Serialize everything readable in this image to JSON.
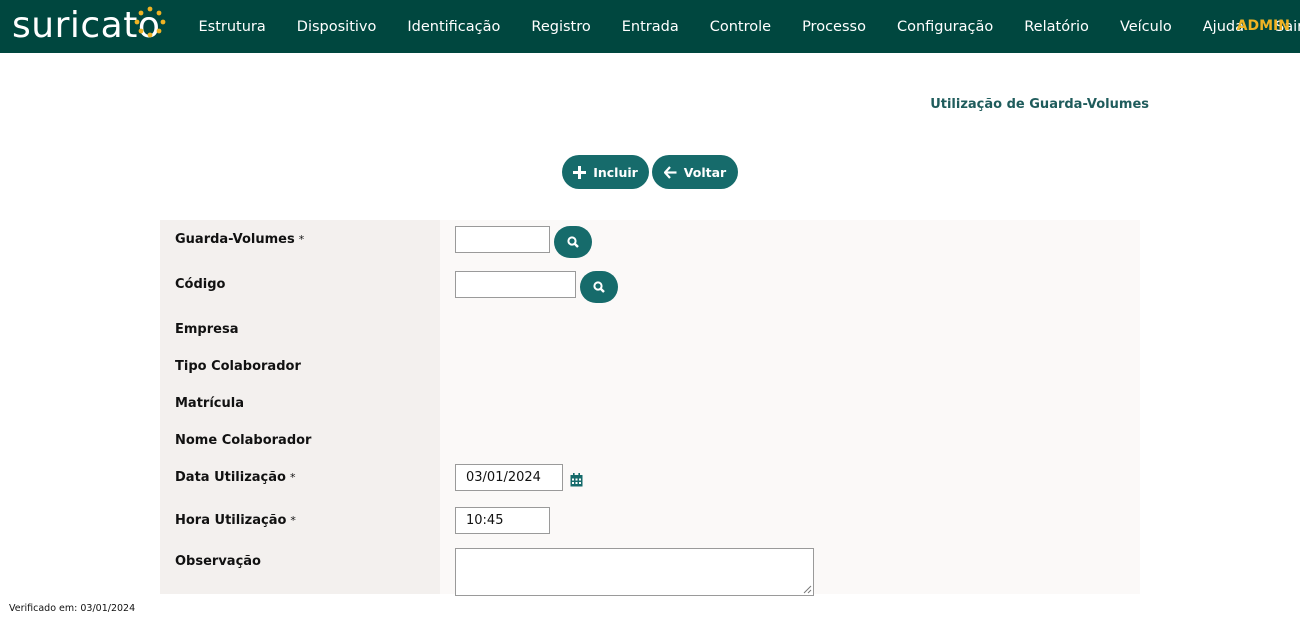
{
  "app": {
    "logo_text": "suricato",
    "brand_colors": {
      "bar": "#00473f",
      "accent": "#f0b323",
      "button": "#166b6b"
    }
  },
  "nav": {
    "items": [
      "Estrutura",
      "Dispositivo",
      "Identificação",
      "Registro",
      "Entrada",
      "Controle",
      "Processo",
      "Configuração",
      "Relatório",
      "Veículo",
      "Ajuda",
      "Sair"
    ],
    "user": "ADMIN"
  },
  "page": {
    "title": "Utilização de Guarda-Volumes"
  },
  "toolbar": {
    "incluir_label": "Incluir",
    "incluir_icon": "plus-icon",
    "voltar_label": "Voltar",
    "voltar_icon": "arrow-left-icon"
  },
  "form": {
    "required_mark": "*",
    "guarda_volumes": {
      "label": "Guarda-Volumes",
      "value": ""
    },
    "codigo": {
      "label": "Código",
      "value": ""
    },
    "empresa": {
      "label": "Empresa"
    },
    "tipo_colaborador": {
      "label": "Tipo Colaborador"
    },
    "matricula": {
      "label": "Matrícula"
    },
    "nome_colaborador": {
      "label": "Nome Colaborador"
    },
    "data_utilizacao": {
      "label": "Data Utilização",
      "value": "03/01/2024"
    },
    "hora_utilizacao": {
      "label": "Hora Utilização",
      "value": "10:45"
    },
    "observacao": {
      "label": "Observação",
      "value": ""
    }
  },
  "footer": {
    "text": "Verificado em: 03/01/2024"
  }
}
